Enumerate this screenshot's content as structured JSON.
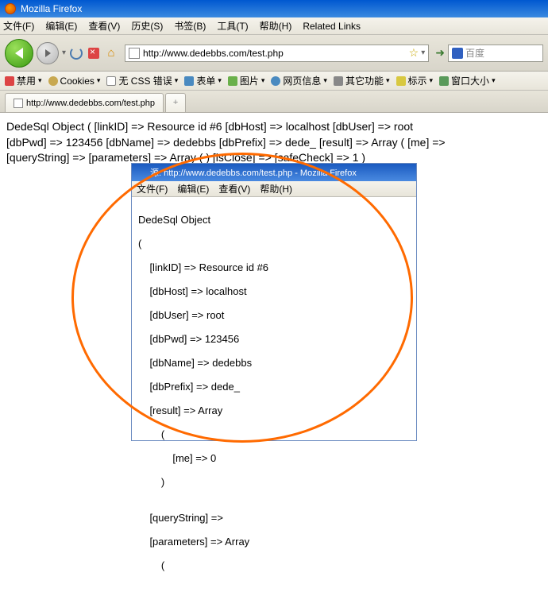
{
  "window": {
    "title": "Mozilla Firefox"
  },
  "menu": {
    "file": "文件(F)",
    "edit": "编辑(E)",
    "view": "查看(V)",
    "history": "历史(S)",
    "bookmarks": "书签(B)",
    "tools": "工具(T)",
    "help": "帮助(H)",
    "related": "Related Links"
  },
  "nav": {
    "url": "http://www.dedebbs.com/test.php",
    "search_placeholder": "百度"
  },
  "devbar": {
    "disable": "禁用",
    "cookies": "Cookies",
    "nocss": "无 CSS 错误",
    "forms": "表单",
    "images": "图片",
    "pageinfo": "网页信息",
    "misc": "其它功能",
    "annotate": "标示",
    "windowsize": "窗口大小"
  },
  "tab": {
    "title": "http://www.dedebbs.com/test.php"
  },
  "dump": {
    "line1": "DedeSql Object ( [linkID] => Resource id #6 [dbHost] => localhost [dbUser] => root",
    "line2": "[dbPwd] => 123456 [dbName] => dedebbs [dbPrefix] => dede_ [result] => Array ( [me] =>",
    "line3": "[queryString] => [parameters] => Array ( ) [isClose] => [safeCheck] => 1 )"
  },
  "source_window": {
    "title": "源: http://www.dedebbs.com/test.php - Mozilla Firefox",
    "menu": {
      "file": "文件(F)",
      "edit": "编辑(E)",
      "view": "查看(V)",
      "help": "帮助(H)"
    },
    "lines": {
      "l1": "DedeSql Object",
      "l2": "(",
      "l3": "    [linkID] => Resource id #6",
      "l4": "    [dbHost] => localhost",
      "l5": "    [dbUser] => root",
      "l6": "    [dbPwd] => 123456",
      "l7": "    [dbName] => dedebbs",
      "l8": "    [dbPrefix] => dede_",
      "l9": "    [result] => Array",
      "l10": "        (",
      "l11": "            [me] => 0",
      "l12": "        )",
      "l13": "",
      "l14": "    [queryString] =>",
      "l15": "    [parameters] => Array",
      "l16": "        ("
    }
  },
  "db_data": {
    "linkID": "Resource id #6",
    "dbHost": "localhost",
    "dbUser": "root",
    "dbPwd": "123456",
    "dbName": "dedebbs",
    "dbPrefix": "dede_",
    "result": {
      "me": 0
    },
    "queryString": "",
    "parameters": [],
    "isClose": "",
    "safeCheck": 1
  }
}
